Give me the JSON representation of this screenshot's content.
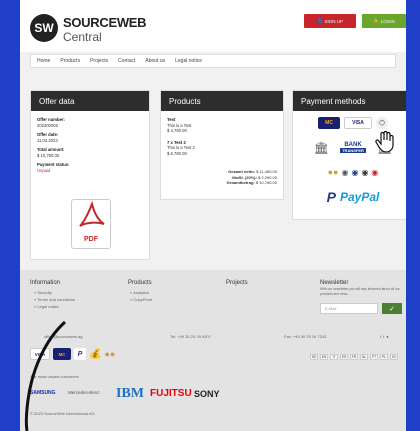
{
  "header": {
    "logo_mark": "SW",
    "logo_text1": "SOURCEWEB",
    "logo_text2": "Central",
    "signup_label": "SIGN UP",
    "login_label": "LOGIN"
  },
  "nav": {
    "items": [
      "Home",
      "Products",
      "Projects",
      "Contact",
      "About us",
      "Legal notice"
    ]
  },
  "offer": {
    "title": "Offer data",
    "fields": [
      {
        "label": "Offer number:",
        "value": "202300002"
      },
      {
        "label": "Offer date:",
        "value": "11.03.2023"
      },
      {
        "label": "Total amount:",
        "value": "$ 10,760.00"
      },
      {
        "label": "Payment status:",
        "value": "Unpaid"
      }
    ],
    "pdf_label": "PDF"
  },
  "products": {
    "title": "Products",
    "items": [
      {
        "name": "Test",
        "desc": "This is a Test",
        "price": "$ 4,760.00"
      },
      {
        "name": "7 x Test 2",
        "desc": "This is a Test 2",
        "price": "$ 6,760.00"
      }
    ],
    "totals": [
      {
        "label": "Gesamt netto:",
        "value": "$ 11,450.00"
      },
      {
        "label": "MwSt. (20%):",
        "value": "$ 2,290.00"
      },
      {
        "label": "Gesamtbetrag:",
        "value": "$ 10,760.00"
      }
    ]
  },
  "payment": {
    "title": "Payment methods",
    "mastercard": "MC",
    "visa": "VISA",
    "bank_label": "BANK",
    "bank_label2": "TRANSFER",
    "paypal_p": "P",
    "paypal_text": "PayPal"
  },
  "footer": {
    "info_title": "Information",
    "info_links": [
      "» Security",
      "» Terms and conditions",
      "» Legal notice"
    ],
    "products_title": "Products",
    "products_links": [
      "» Analytics",
      "» CopyProof"
    ],
    "projects_title": "Projects",
    "newsletter_title": "Newsletter",
    "newsletter_text": "With our newsletter you will stay informed about all our products and news",
    "newsletter_placeholder": "E-Mail",
    "newsletter_btn": "✓",
    "email": "office@sourceweb.ag",
    "tel": "Tel: +49 30 29 29 0007",
    "fax": "Fax: +49 30 29 16 7243",
    "languages": [
      "DE",
      "EN",
      "IT",
      "ES",
      "FR",
      "NL",
      "PT",
      "PL",
      "SV"
    ],
    "customers_label": "Our most valued customers",
    "brands": [
      "SAMSUNG",
      "Mercedes-Benz",
      "IBM",
      "FUJITSU",
      "SONY"
    ],
    "copyright": "© 2023 SourceWeb International AG",
    "pay_visa": "VISA",
    "pay_mc": "MC",
    "pay_pp": "P"
  }
}
